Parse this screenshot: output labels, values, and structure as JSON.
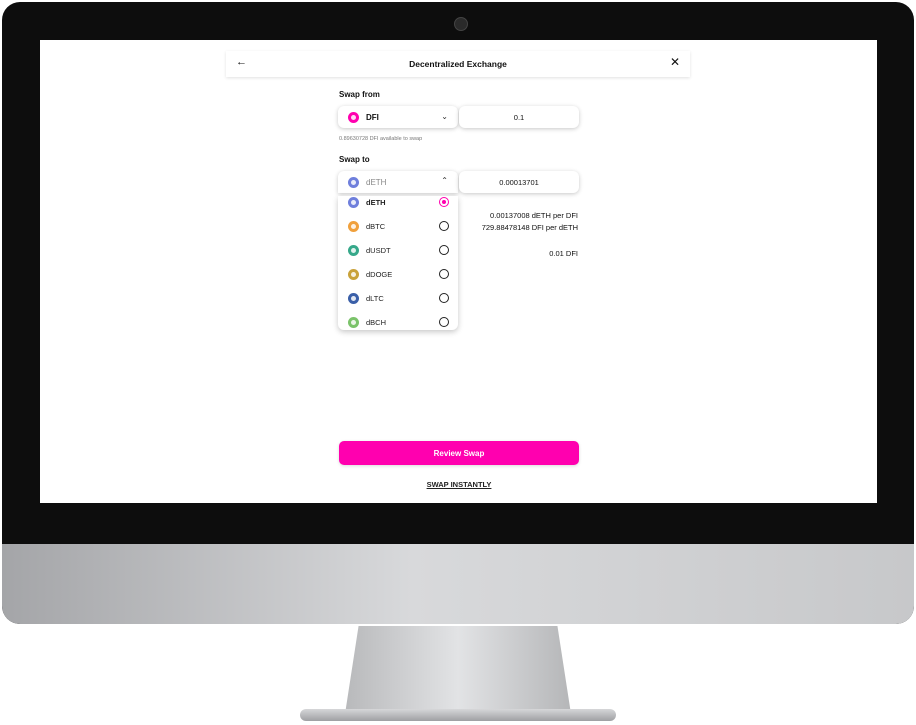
{
  "header": {
    "title": "Decentralized Exchange"
  },
  "swap_from": {
    "label": "Swap from",
    "token": "DFI",
    "amount": "0.1",
    "available": "0.89630728 DFI available to swap"
  },
  "swap_to": {
    "label": "Swap to",
    "token": "dETH",
    "amount": "0.00013701"
  },
  "rates": {
    "line1": "0.00137008 dETH per DFI",
    "line2": "729.88478148 DFI per dETH",
    "fee": "0.01 DFI"
  },
  "dropdown": {
    "options": [
      {
        "label": "dETH",
        "color": "#6f7fdc",
        "selected": true
      },
      {
        "label": "dBTC",
        "color": "#f0a03c",
        "selected": false
      },
      {
        "label": "dUSDT",
        "color": "#36a88a",
        "selected": false
      },
      {
        "label": "dDOGE",
        "color": "#c9a23a",
        "selected": false
      },
      {
        "label": "dLTC",
        "color": "#3a5fa8",
        "selected": false
      },
      {
        "label": "dBCH",
        "color": "#7bc36a",
        "selected": false
      }
    ]
  },
  "actions": {
    "review": "Review Swap",
    "instant": "SWAP INSTANTLY"
  },
  "icons": {
    "back": "arrow-left",
    "close": "close-x",
    "chevron_down": "chevron-down",
    "chevron_up": "chevron-up"
  },
  "colors": {
    "accent": "#ff00af"
  }
}
